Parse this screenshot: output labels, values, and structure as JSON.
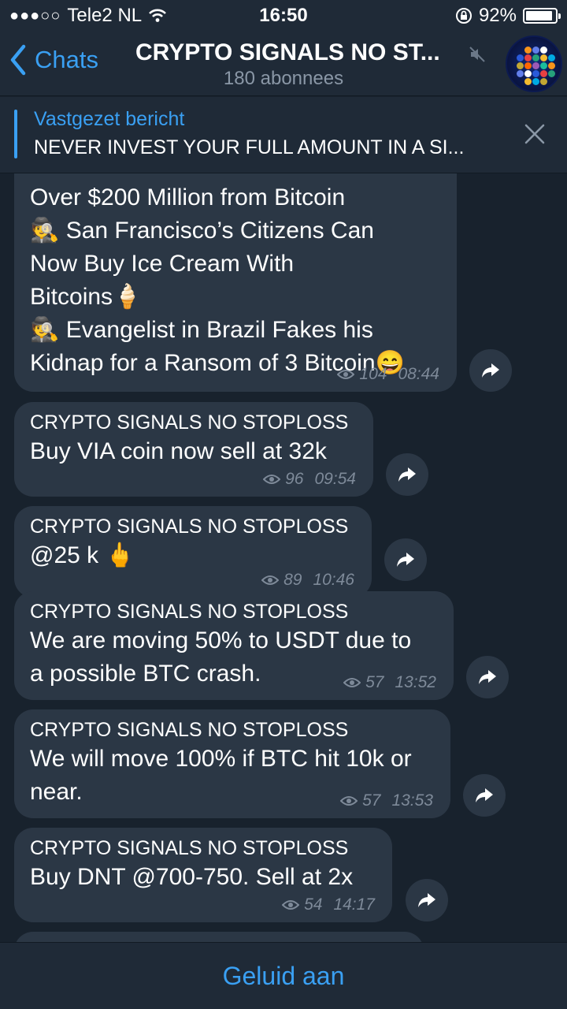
{
  "status_bar": {
    "carrier": "Tele2 NL",
    "time": "16:50",
    "battery_percent": "92%",
    "battery_level": 0.92,
    "signal_dots": "●●●○○"
  },
  "nav": {
    "back_label": "Chats",
    "title": "CRYPTO SIGNALS NO ST...",
    "subtitle": "180 abonnees",
    "icons": [
      "chevron-left-icon",
      "mute-icon",
      "channel-avatar"
    ]
  },
  "pinned": {
    "title": "Vastgezet bericht",
    "text": "NEVER INVEST YOUR FULL AMOUNT IN A SI..."
  },
  "messages": [
    {
      "sender": "",
      "lines": [
        "Over $200 Million from Bitcoin",
        "🕵 San Francisco’s Citizens Can",
        "Now Buy Ice Cream With",
        "Bitcoins🍦",
        "🕵 Evangelist in Brazil Fakes his",
        "Kidnap for a Ransom of 3 Bitcoin😄"
      ],
      "views": "104",
      "time": "08:44"
    },
    {
      "sender": "CRYPTO SIGNALS NO STOPLOSS",
      "lines": [
        "Buy VIA coin now  sell at 32k"
      ],
      "views": "96",
      "time": "09:54"
    },
    {
      "sender": "CRYPTO SIGNALS NO STOPLOSS",
      "lines": [
        "@25 k 🖕"
      ],
      "views": "89",
      "time": "10:46"
    },
    {
      "sender": "CRYPTO SIGNALS NO STOPLOSS",
      "lines": [
        "We are moving 50% to USDT due to",
        "a possible BTC crash."
      ],
      "views": "57",
      "time": "13:52"
    },
    {
      "sender": "CRYPTO SIGNALS NO STOPLOSS",
      "lines": [
        "We will move 100% if BTC hit 10k or",
        "near."
      ],
      "views": "57",
      "time": "13:53"
    },
    {
      "sender": "CRYPTO SIGNALS NO STOPLOSS",
      "lines": [
        "Buy DNT @700-750. Sell at 2x"
      ],
      "views": "54",
      "time": "14:17"
    }
  ],
  "bottom_bar": {
    "label": "Geluid aan"
  },
  "colors": {
    "background": "#18222d",
    "bar": "#1f2a37",
    "bubble": "#2b3745",
    "accent": "#3aa0f3",
    "meta": "#7e8a99"
  }
}
